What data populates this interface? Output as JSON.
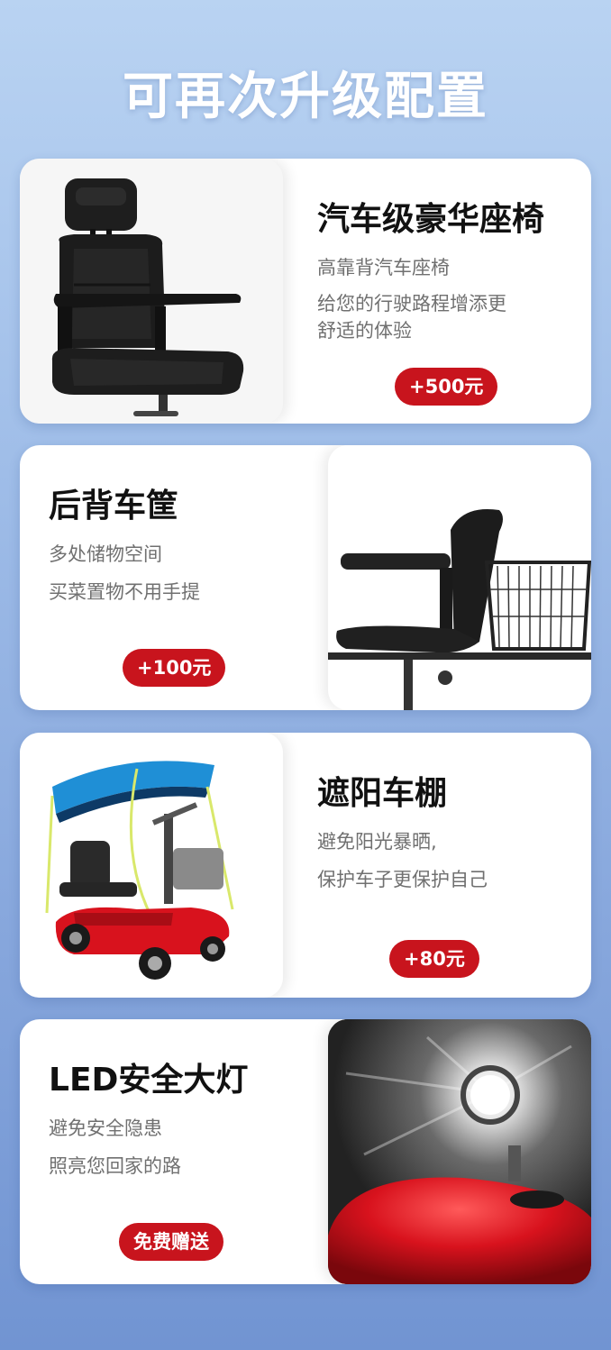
{
  "page_title": "可再次升级配置",
  "cards": [
    {
      "heading": "汽车级豪华座椅",
      "lines": [
        "高靠背汽车座椅",
        "给您的行驶路程增添更",
        "舒适的体验"
      ],
      "price": "+500元"
    },
    {
      "heading": "后背车筐",
      "lines": [
        "多处储物空间",
        "买菜置物不用手提"
      ],
      "price": "+100元"
    },
    {
      "heading": "遮阳车棚",
      "lines": [
        "避免阳光暴晒,",
        "保护车子更保护自己"
      ],
      "price": "+80元"
    },
    {
      "heading": "LED安全大灯",
      "lines": [
        "避免安全隐患",
        "照亮您回家的路"
      ],
      "price": "免费赠送"
    }
  ],
  "colors": {
    "price_badge": "#c8141d",
    "heading_text": "#111111",
    "desc_text": "#707070",
    "scooter_body": "#d8121d",
    "canopy": "#1f8fd6"
  }
}
